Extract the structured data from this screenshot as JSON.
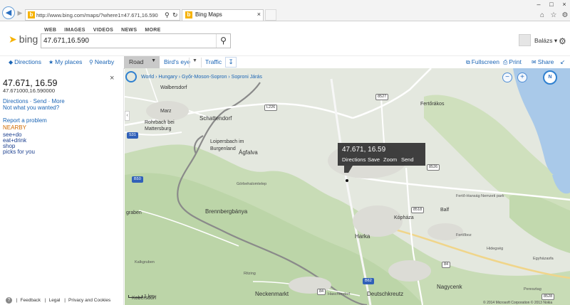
{
  "browser": {
    "url": "http://www.bing.com/maps/?where1=47.671,16.590",
    "tab_title": "Bing Maps"
  },
  "bing": {
    "nav": [
      "WEB",
      "IMAGES",
      "VIDEOS",
      "NEWS",
      "MORE"
    ],
    "logo_text": "bing",
    "search_value": "47.671,16.590",
    "user_name": "Balázs"
  },
  "toolbar": {
    "directions": "Directions",
    "my_places": "My places",
    "nearby": "Nearby",
    "road": "Road",
    "birds_eye": "Bird's eye",
    "traffic": "Traffic",
    "fullscreen": "Fullscreen",
    "print": "Print",
    "share": "Share"
  },
  "panel": {
    "title": "47.671, 16.59",
    "subtitle": "47.671000,16.590000",
    "actions": "Directions · Send · More",
    "not_wanted": "Not what you wanted?",
    "report": "Report a problem",
    "nearby": "NEARBY",
    "categories": [
      "see+do",
      "eat+drink",
      "shop",
      "picks for you"
    ],
    "footer": [
      "Feedback",
      "Legal",
      "Privacy and Cookies"
    ]
  },
  "map": {
    "breadcrumb": "World › Hungary › Győr-Moson-Sopron › Soproni Járás",
    "popup": {
      "title": "47.671, 16.59",
      "actions": [
        "Directions",
        "Save",
        "Zoom",
        "Send"
      ]
    },
    "rotate_label": "N",
    "places": [
      "Walbersdorf",
      "Marz",
      "Rohrbach bei",
      "Mattersburg",
      "Schattendorf",
      "Loipersbach im",
      "Burgenland",
      "Ágfalva",
      "Görbehalomtelep",
      "Brennbergbánya",
      "Harka",
      "Kópháza",
      "Balf",
      "Fertőrákos",
      "Fertőboz",
      "Hidegség",
      "Nagycenk",
      "Peresztag",
      "Ritzing",
      "Neckenmarkt",
      "Deutschkreutz",
      "Haschendorf",
      "Kalkgruben",
      "Egyházasfa",
      "Fertő-Hanság Nemzeti park",
      "graben",
      "Kobersdorf"
    ],
    "road_numbers": [
      "L226",
      "S31",
      "B50",
      "8527",
      "8526",
      "8518",
      "84",
      "B62",
      "84",
      "8528"
    ],
    "scale": "1 km",
    "copyright": "© 2014 Microsoft Corporation  © 2013 Nokia"
  }
}
